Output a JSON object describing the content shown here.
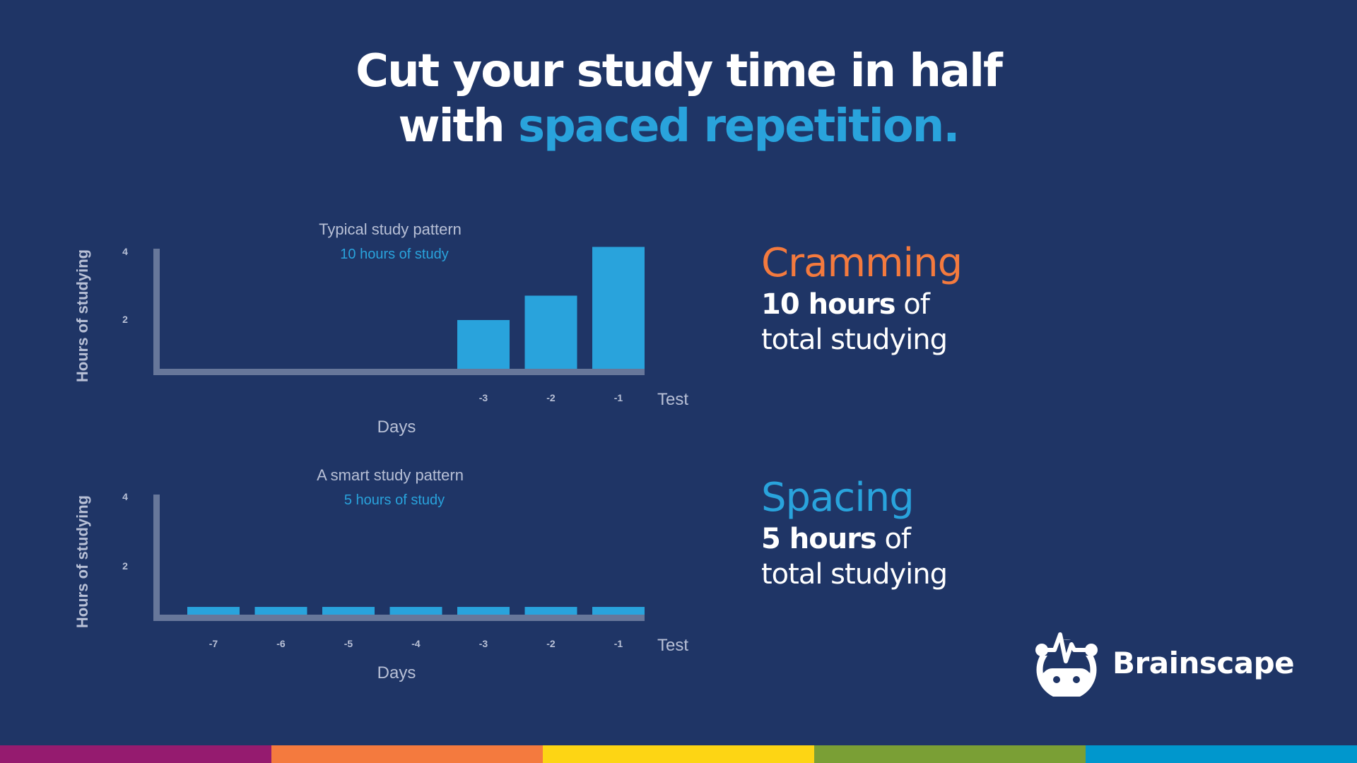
{
  "headline": {
    "line1": "Cut your study time in half",
    "line2_prefix": "with ",
    "line2_accent": "spaced repetition."
  },
  "colors": {
    "background": "#1f3566",
    "bar": "#29a3dc",
    "axis": "#67779a",
    "label": "#b8c0d6",
    "cramming": "#f47a3e",
    "spacing": "#29a3dc",
    "stripes": [
      "#951b6f",
      "#f47a3e",
      "#fdd514",
      "#7a9f35",
      "#0097cd"
    ]
  },
  "chart_data": [
    {
      "type": "bar",
      "title": "Typical study pattern",
      "subtitle": "10 hours of study",
      "xlabel": "Days",
      "ylabel": "Hours of studying",
      "x_end_label": "Test",
      "categories": [
        "-3",
        "-2",
        "-1"
      ],
      "values": [
        2,
        3,
        5
      ],
      "yticks": [
        2,
        4
      ],
      "ylim": [
        0,
        5
      ],
      "grid": false
    },
    {
      "type": "bar",
      "title": "A smart study pattern",
      "subtitle": "5 hours of study",
      "xlabel": "Days",
      "ylabel": "Hours of studying",
      "x_end_label": "Test",
      "categories": [
        "-7",
        "-6",
        "-5",
        "-4",
        "-3",
        "-2",
        "-1"
      ],
      "values": [
        0.71,
        0.71,
        0.71,
        0.71,
        0.71,
        0.71,
        0.71
      ],
      "yticks": [
        2,
        4
      ],
      "ylim": [
        0,
        5
      ],
      "grid": false
    }
  ],
  "side": {
    "cramming": {
      "title": "Cramming",
      "bold": "10 hours",
      "rest": " of",
      "line2": "total studying"
    },
    "spacing": {
      "title": "Spacing",
      "bold": "5 hours",
      "rest": " of",
      "line2": "total studying"
    }
  },
  "logo": {
    "name": "Brainscape",
    "icon": "brain-robot-icon"
  }
}
